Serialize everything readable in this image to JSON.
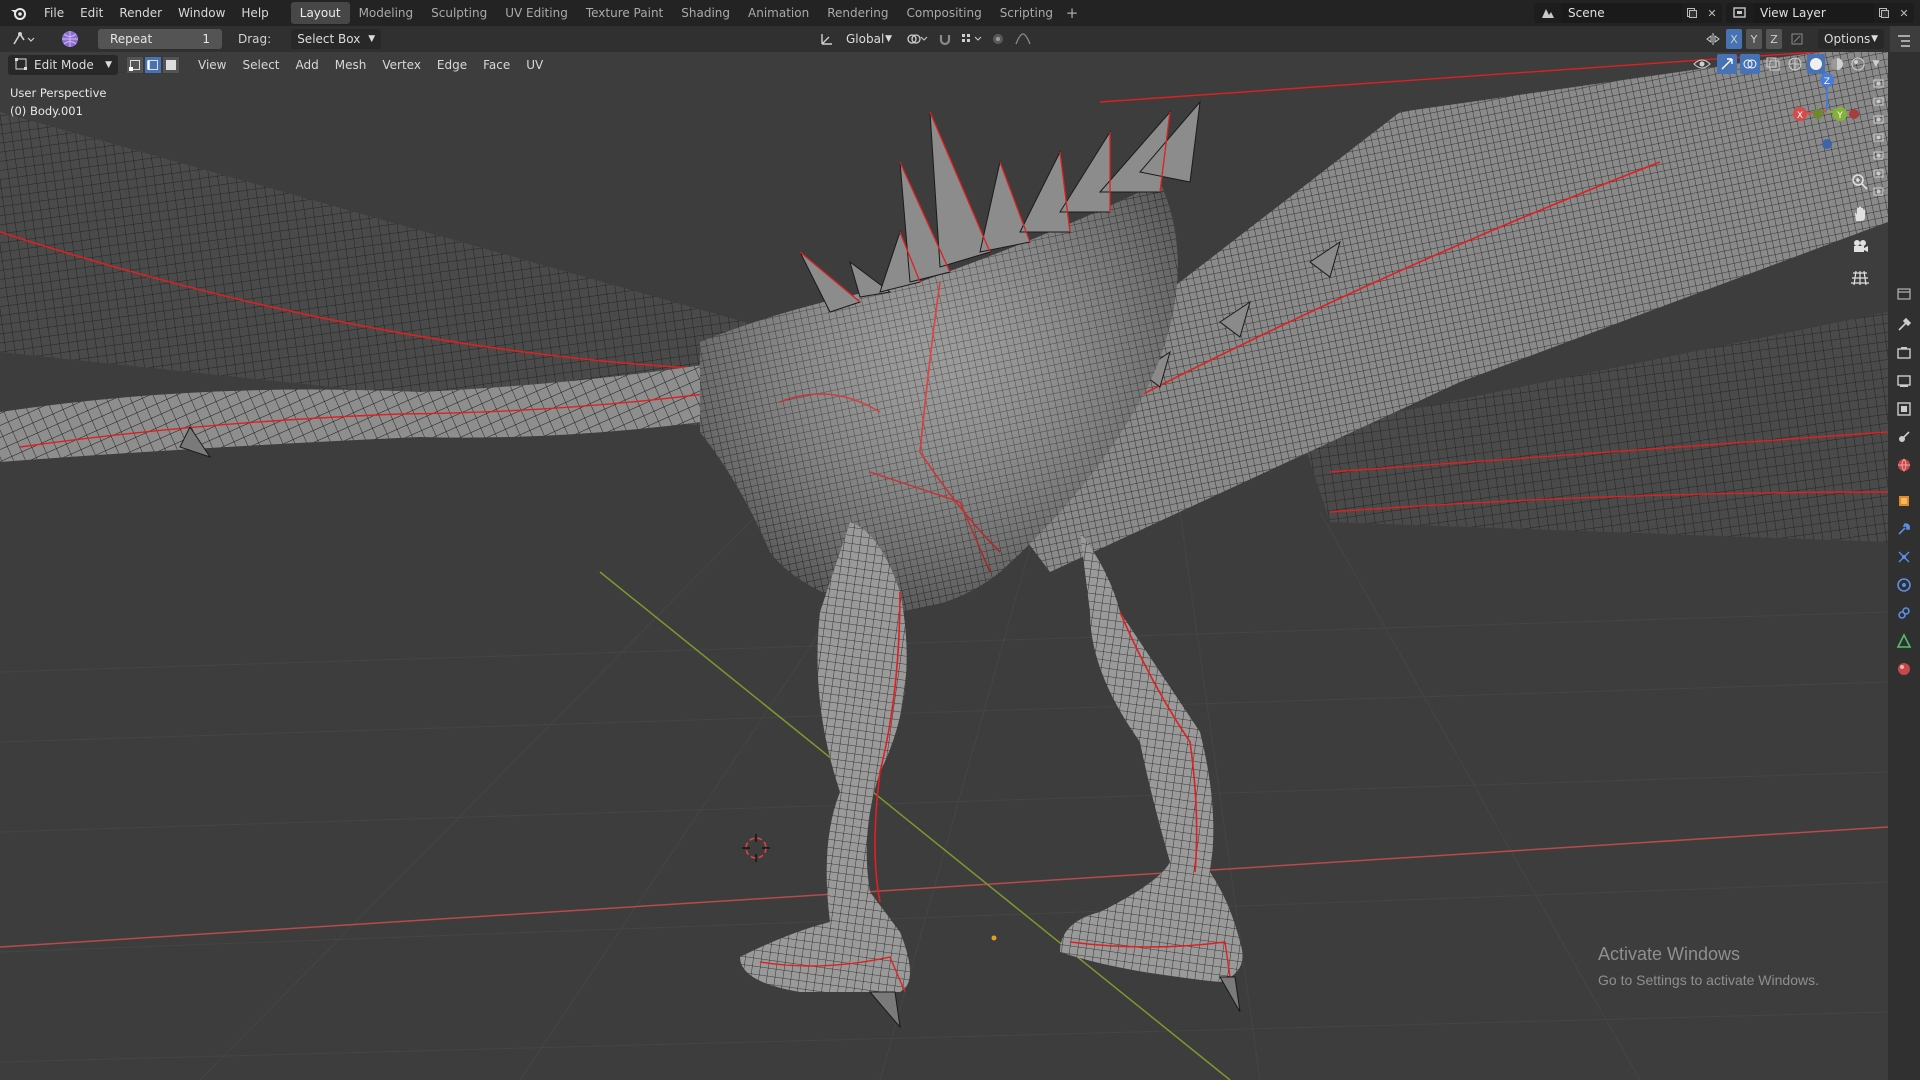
{
  "menu": [
    "File",
    "Edit",
    "Render",
    "Window",
    "Help"
  ],
  "workspaces": [
    "Layout",
    "Modeling",
    "Sculpting",
    "UV Editing",
    "Texture Paint",
    "Shading",
    "Animation",
    "Rendering",
    "Compositing",
    "Scripting"
  ],
  "active_workspace": "Layout",
  "scene": {
    "label": "Scene"
  },
  "view_layer": {
    "label": "View Layer"
  },
  "tool_header": {
    "repeat_label": "Repeat",
    "repeat_value": "1",
    "drag_label": "Drag:",
    "drag_value": "Select Box",
    "transform_orientation": "Global",
    "options_label": "Options",
    "axes": [
      "X",
      "Y",
      "Z"
    ]
  },
  "edit_header": {
    "mode": "Edit Mode",
    "menus": [
      "View",
      "Select",
      "Add",
      "Mesh",
      "Vertex",
      "Edge",
      "Face",
      "UV"
    ]
  },
  "viewport": {
    "perspective": "User Perspective",
    "object": "(0) Body.001"
  },
  "gizmo": {
    "x": "X",
    "y": "Y",
    "z": "Z"
  },
  "watermark": {
    "title": "Activate Windows",
    "subtitle": "Go to Settings to activate Windows."
  },
  "colors": {
    "topbar": "#232323",
    "header": "#303030",
    "viewport": "#3d3d3d",
    "active_blue": "#4772b3",
    "seam_red": "#e02020",
    "axis_red": "#b84a4a",
    "axis_green": "#7c9a2e"
  },
  "icons": [
    "blender-logo-icon",
    "editor-type-icon",
    "edit-mesh-icon",
    "vertex-select-icon",
    "edge-select-icon",
    "face-select-icon",
    "zoom-icon",
    "hand-pan-icon",
    "camera-icon",
    "grid-icon",
    "tool-icon",
    "render-icon",
    "output-icon",
    "view-layer-icon",
    "scene-icon",
    "world-icon",
    "object-icon",
    "modifier-icon",
    "particles-icon",
    "physics-icon",
    "constraints-icon",
    "data-icon",
    "material-icon"
  ]
}
